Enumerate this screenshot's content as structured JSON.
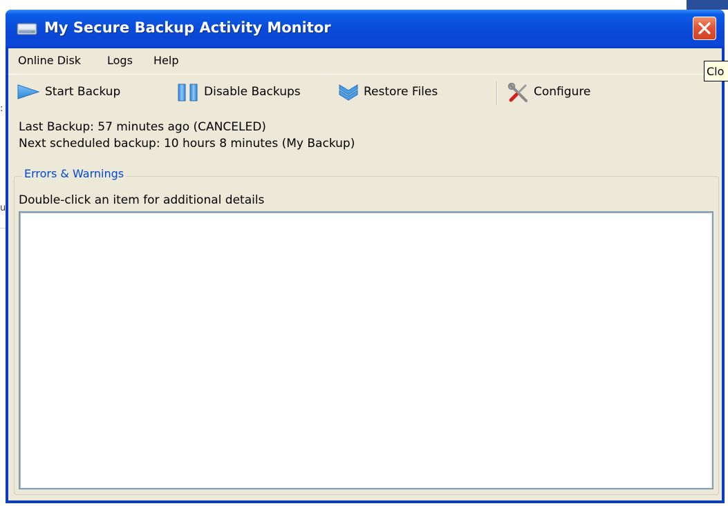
{
  "window": {
    "title": "My Secure Backup Activity Monitor",
    "title_icon": "drive-icon",
    "close_icon": "close-icon",
    "accent_color": "#0a46d6",
    "close_color": "#e2553a"
  },
  "menu": {
    "items": [
      "Online Disk",
      "Logs",
      "Help"
    ]
  },
  "toolbar": {
    "start_backup": {
      "label": "Start Backup",
      "icon": "play-arrow-icon"
    },
    "disable_backups": {
      "label": "Disable Backups",
      "icon": "pause-icon"
    },
    "restore_files": {
      "label": "Restore Files",
      "icon": "double-chevron-down-icon"
    },
    "configure": {
      "label": "Configure",
      "icon": "wrench-screwdriver-icon"
    }
  },
  "status": {
    "last_backup": "Last Backup: 57 minutes ago (CANCELED)",
    "next_backup": "Next scheduled backup: 10 hours 8 minutes (My Backup)"
  },
  "errors_group": {
    "legend": "Errors & Warnings",
    "legend_color": "#0046d5",
    "hint": "Double-click an item for additional details",
    "items": []
  },
  "tooltip": {
    "text": "Clo"
  },
  "background": {
    "fragment_chars": [
      ":",
      "u"
    ]
  }
}
